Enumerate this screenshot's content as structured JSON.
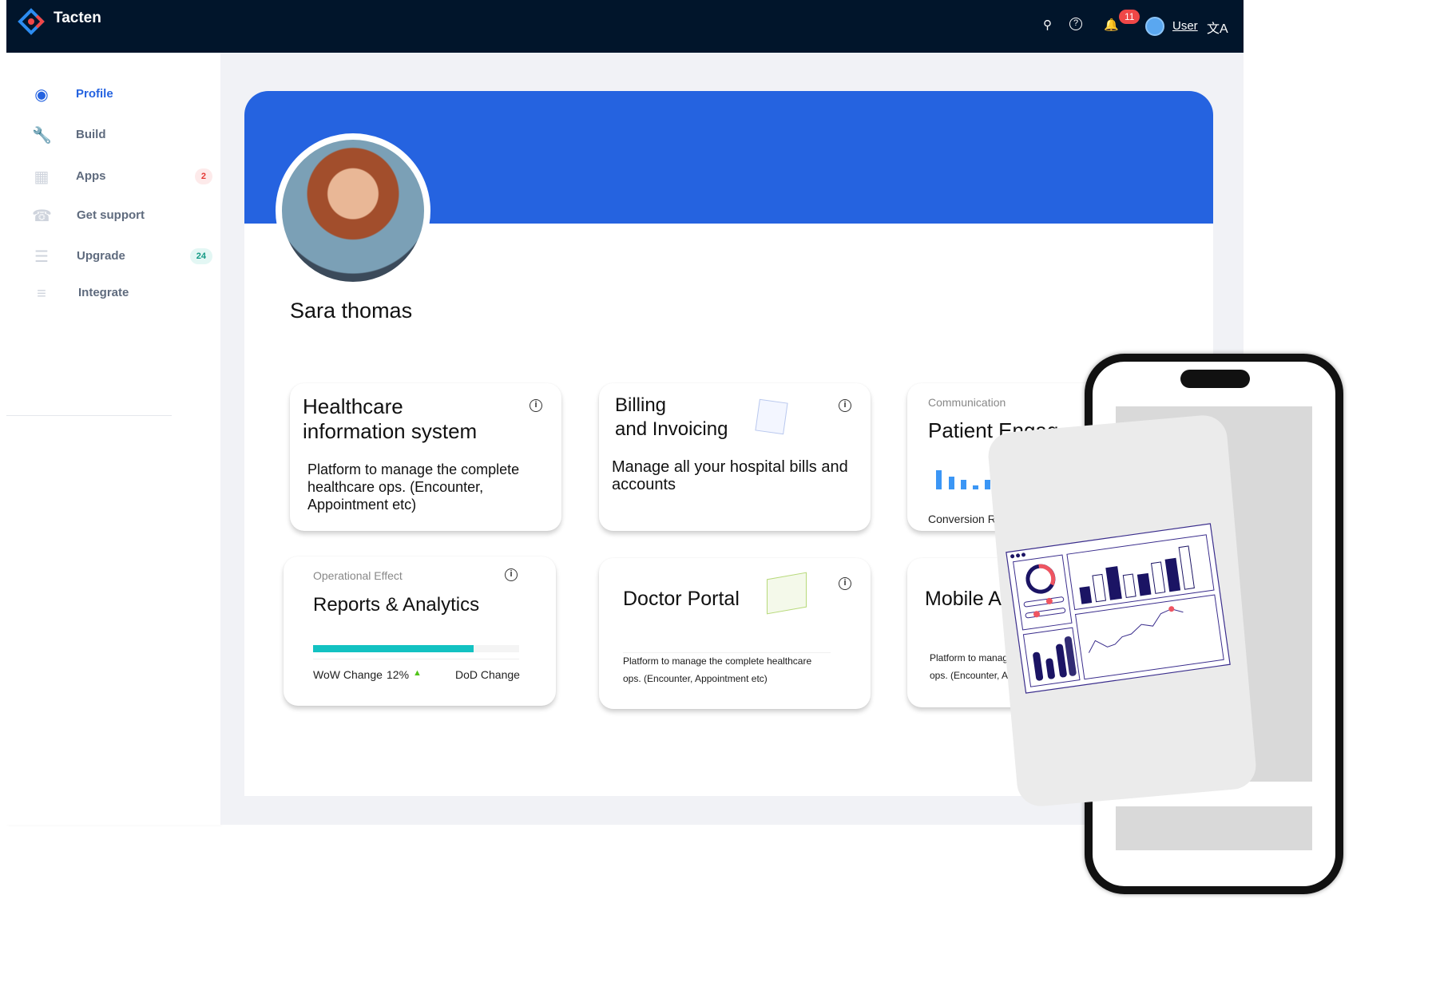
{
  "app": {
    "title": "Tacten",
    "notifications": "11",
    "user_label": "User",
    "colors": {
      "nav": "#01152b",
      "accent": "#2563e0",
      "progress": "#13c2c2"
    }
  },
  "nav_icons": [
    "search-icon",
    "help-icon",
    "bell-icon",
    "translate-icon"
  ],
  "sidebar": {
    "items": [
      {
        "label": "Profile",
        "icon": "user-icon",
        "active": true
      },
      {
        "label": "Build",
        "icon": "wrench-icon"
      },
      {
        "label": "Apps",
        "icon": "apps-icon",
        "badge": "2"
      },
      {
        "label": "Get support",
        "icon": "support-icon"
      },
      {
        "label": "Upgrade",
        "icon": "upgrade-icon",
        "badge": "24"
      },
      {
        "label": "Integrate",
        "icon": "sliders-icon"
      }
    ]
  },
  "profile": {
    "name": "Sara thomas"
  },
  "cards": {
    "his": {
      "title1": "Healthcare",
      "title2": "information system",
      "body": "Platform to manage the complete healthcare ops. (Encounter, Appointment etc)"
    },
    "billing": {
      "title1": "Billing",
      "title2": "and Invoicing",
      "body": "Manage all your hospital bills and accounts"
    },
    "patient": {
      "label": "Communication",
      "title": "Patient Engag",
      "footer": "Conversion Ra"
    },
    "reports": {
      "label": "Operational Effect",
      "title": "Reports & Analytics",
      "progress_percent": 78,
      "wow_label": "WoW Change",
      "wow_value": "12%",
      "dod_label": "DoD Change"
    },
    "doctor": {
      "title": "Doctor Portal",
      "body1": "Platform to manage the complete healthcare",
      "body2": "ops. (Encounter, Appointment etc)"
    },
    "mobile": {
      "title": "Mobile Ap",
      "body1": "Platform to manage",
      "body2": "ops. (Encounter, Ap"
    }
  }
}
